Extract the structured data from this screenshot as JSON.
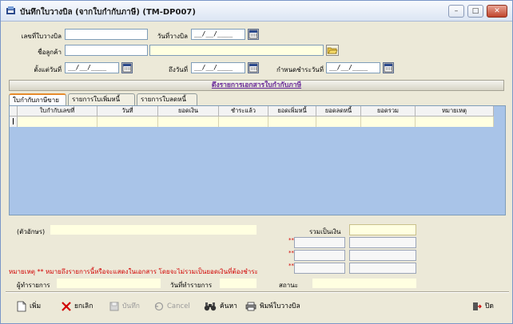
{
  "window": {
    "title": "บันทึกใบวางบิล (จากใบกำกับภาษี) (TM-DP007)",
    "controls": {
      "minimize": "–",
      "maximize": "□",
      "close": "✕"
    }
  },
  "form": {
    "bill_no_label": "เลขที่ใบวางบิล",
    "bill_no_value": "",
    "bill_date_label": "วันที่วางบิล",
    "bill_date_value": "__/__/____",
    "customer_label": "ชื่อลูกค้า",
    "customer_code_value": "",
    "customer_name_value": "",
    "from_date_label": "ตั้งแต่วันที่",
    "from_date_value": "__/__/____",
    "to_date_label": "ถึงวันที่",
    "to_date_value": "__/__/____",
    "due_date_label": "กำหนดชำระวันที่",
    "due_date_value": "__/__/____"
  },
  "fetch_bar": {
    "label": "ดึงรายการเอกสารใบกำกับภาษี"
  },
  "tabs": [
    {
      "label": "ใบกำกับภาษีขาย",
      "active": true
    },
    {
      "label": "รายการใบเพิ่มหนี้",
      "active": false
    },
    {
      "label": "รายการใบลดหนี้",
      "active": false
    }
  ],
  "grid": {
    "columns": [
      "ใบกำกับเลขที่",
      "วันที่",
      "ยอดเงิน",
      "ชำระแล้ว",
      "ยอดเพิ่มหนี้",
      "ยอดลดหนี้",
      "ยอดรวม",
      "หมายเหตุ"
    ],
    "rows": [
      [
        "",
        "",
        "",
        "",
        "",
        "",
        "",
        ""
      ]
    ]
  },
  "summary": {
    "text_amount_label": "(ตัวอักษร)",
    "total_label": "รวมเป็นเงิน",
    "marks": [
      "**",
      "**",
      "**"
    ],
    "note": "หมายเหตุ ** หมายถึงรายการนี้หรือจะแสดงในเอกสาร โดยจะไม่รวมเป็นยอดเงินที่ต้องชำระ",
    "operator_label": "ผู้ทำรายการ",
    "operation_date_label": "วันที่ทำรายการ",
    "status_label": "สถานะ"
  },
  "toolbar": {
    "add": "เพิ่ม",
    "cancel": "ยกเลิก",
    "save": "บันทึก",
    "undo": "Cancel",
    "search": "ค้นหา",
    "print": "พิมพ์ใบวางบิล",
    "close": "ปิด"
  },
  "colors": {
    "accent": "#6a2a9a",
    "grid_bg": "#a9c4e8",
    "field_yellow": "#ffffe1",
    "note_red": "#d10000"
  }
}
